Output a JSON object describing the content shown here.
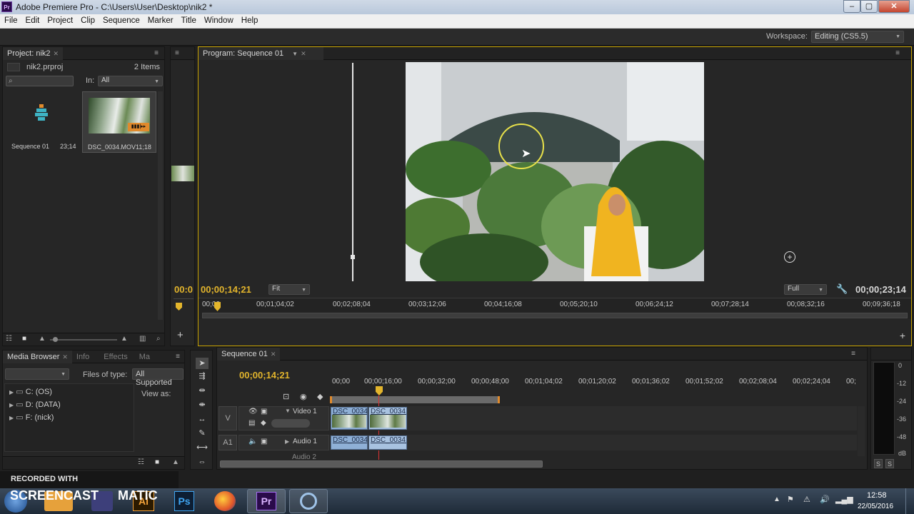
{
  "app": {
    "title": "Adobe Premiere Pro - C:\\Users\\User\\Desktop\\nik2 *",
    "icon_label": "Pr"
  },
  "menu": [
    "File",
    "Edit",
    "Project",
    "Clip",
    "Sequence",
    "Marker",
    "Title",
    "Window",
    "Help"
  ],
  "workspace": {
    "label": "Workspace:",
    "value": "Editing (CS5.5)"
  },
  "project_panel": {
    "tab": "Project: nik2",
    "file": "nik2.prproj",
    "count": "2 Items",
    "in_label": "In:",
    "in_value": "All",
    "items": [
      {
        "name": "Sequence 01",
        "duration": "23;14"
      },
      {
        "name": "DSC_0034.MOV",
        "duration": "11;18"
      }
    ]
  },
  "program_monitor": {
    "tab": "Program: Sequence 01",
    "timecode_left_partial": "00:0",
    "timecode_current": "00;00;14;21",
    "fit": "Fit",
    "quality": "Full",
    "timecode_duration": "00;00;23;14",
    "ruler": [
      "00;00",
      "00;01;04;02",
      "00;02;08;04",
      "00;03;12;06",
      "00;04;16;08",
      "00;05;20;10",
      "00;06;24;12",
      "00;07;28;14",
      "00;08;32;16",
      "00;09;36;18"
    ],
    "transport": [
      "◆",
      "{",
      "}",
      "|◂◂",
      "◂|",
      "▶",
      "|▸",
      "▸▸|",
      "⊟",
      "⊞",
      "◙"
    ]
  },
  "media_browser": {
    "tabs": [
      "Media Browser",
      "Info",
      "Effects",
      "Ma"
    ],
    "files_of_type_label": "Files of type:",
    "files_of_type_value": "All Supported",
    "view_as": "View as:",
    "drives": [
      "C: (OS)",
      "D: (DATA)",
      "F: (nick)"
    ]
  },
  "timeline": {
    "tab": "Sequence 01",
    "timecode": "00;00;14;21",
    "ruler": [
      "00;00",
      "00;00;16;00",
      "00;00;32;00",
      "00;00;48;00",
      "00;01;04;02",
      "00;01;20;02",
      "00;01;36;02",
      "00;01;52;02",
      "00;02;08;04",
      "00;02;24;04",
      "00;"
    ],
    "tracks": [
      {
        "target": "V",
        "name": "Video 1",
        "clips": [
          "DSC_0034",
          "DSC_0034."
        ]
      },
      {
        "target": "A1",
        "name": "Audio 1",
        "clips": [
          "DSC_0034",
          "DSC_0034."
        ]
      }
    ],
    "next_track": "Audio 2"
  },
  "audio_meter": {
    "scale": [
      "0",
      "-12",
      "-24",
      "-36",
      "-48",
      "dB"
    ],
    "solo_left": "S",
    "solo_right": "S"
  },
  "watermark": {
    "line1": "RECORDED WITH",
    "line2": "SCREENCAST",
    "line3": "MATIC"
  },
  "taskbar": {
    "time": "12:58",
    "date": "22/05/2016",
    "apps": [
      "Ai",
      "Ps",
      "Pr"
    ]
  },
  "colors": {
    "accent_timecode": "#e3b52c",
    "clip_blue": "#8fb0d6",
    "panel_bg": "#262626"
  }
}
